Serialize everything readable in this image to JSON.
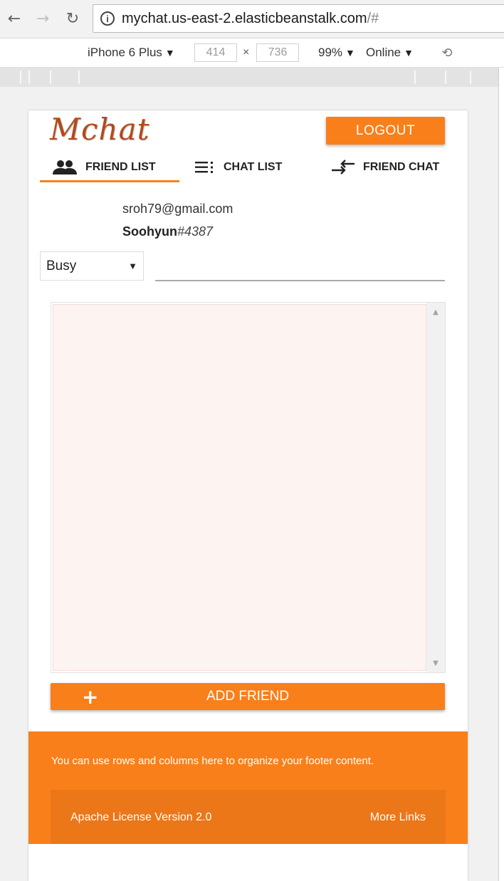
{
  "browser": {
    "url_host": "mychat.us-east-2.elasticbeanstalk.com",
    "url_path": "/#"
  },
  "devtools": {
    "device": "iPhone 6 Plus",
    "width": "414",
    "times": "×",
    "height": "736",
    "zoom": "99%",
    "network": "Online"
  },
  "app": {
    "logo": "Mchat",
    "logout_label": "LOGOUT",
    "tabs": [
      {
        "label": "FRIEND LIST",
        "icon": "people-icon",
        "active": true
      },
      {
        "label": "CHAT LIST",
        "icon": "list-icon",
        "active": false
      },
      {
        "label": "FRIEND CHAT",
        "icon": "swap-arrows-icon",
        "active": false
      }
    ],
    "user": {
      "email": "sroh79@gmail.com",
      "name": "Soohyun",
      "tag": "#4387"
    },
    "status": {
      "selected": "Busy",
      "message_value": ""
    },
    "friends": [],
    "add_friend_label": "ADD FRIEND",
    "add_friend_icon": "+"
  },
  "footer": {
    "text": "You can use rows and columns here to organize your footer content.",
    "license": "Apache License Version 2.0",
    "more_links": "More Links"
  },
  "colors": {
    "accent": "#f97f1a",
    "logo": "#b5481b",
    "list_background": "#fdf4f2"
  }
}
